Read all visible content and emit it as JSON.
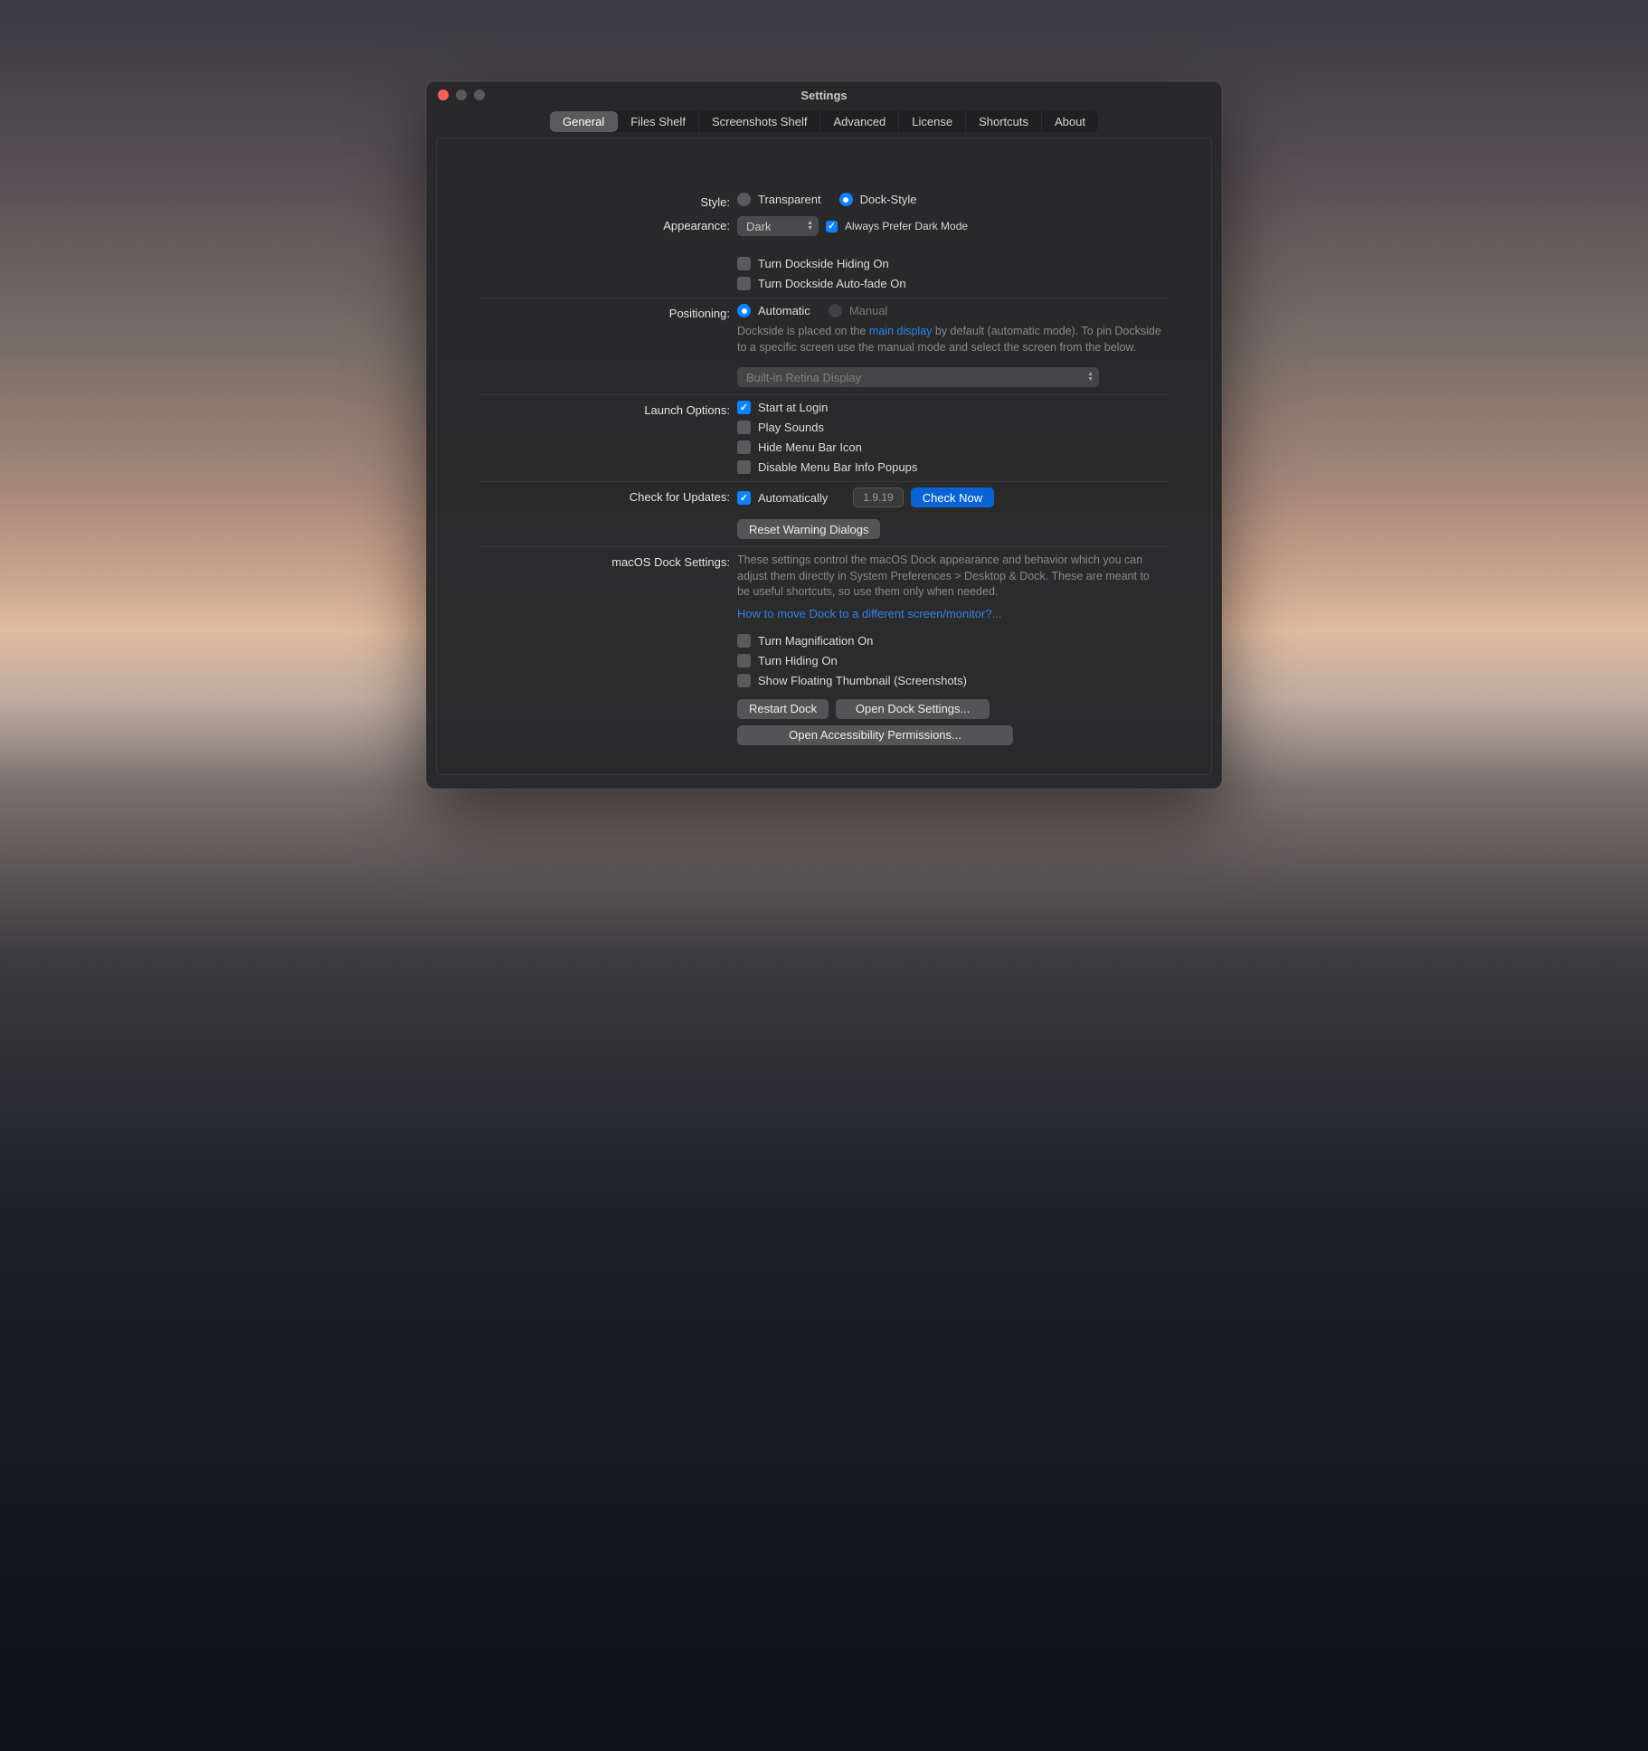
{
  "window": {
    "title": "Settings"
  },
  "tabs": [
    "General",
    "Files Shelf",
    "Screenshots Shelf",
    "Advanced",
    "License",
    "Shortcuts",
    "About"
  ],
  "selected_tab": 0,
  "style": {
    "label": "Style:",
    "options": {
      "transparent": "Transparent",
      "dock": "Dock-Style"
    },
    "selected": "dock"
  },
  "appearance": {
    "label": "Appearance:",
    "value": "Dark",
    "always_dark_label": "Always Prefer Dark Mode",
    "always_dark_checked": true,
    "hiding_label": "Turn Dockside Hiding On",
    "hiding_checked": false,
    "autofade_label": "Turn Dockside Auto-fade On",
    "autofade_checked": false
  },
  "positioning": {
    "label": "Positioning:",
    "options": {
      "automatic": "Automatic",
      "manual": "Manual"
    },
    "selected": "automatic",
    "help_pre": "Dockside is placed on the ",
    "help_link": "main display",
    "help_post": " by default (automatic mode). To pin Dockside to a specific screen use the manual mode and select the screen from the below.",
    "display_value": "Built-in Retina Display"
  },
  "launch": {
    "label": "Launch Options:",
    "start_login": {
      "label": "Start at Login",
      "checked": true
    },
    "play_sounds": {
      "label": "Play Sounds",
      "checked": false
    },
    "hide_menubar": {
      "label": "Hide Menu Bar Icon",
      "checked": false
    },
    "disable_popups": {
      "label": "Disable Menu Bar Info Popups",
      "checked": false
    }
  },
  "updates": {
    "label": "Check for Updates:",
    "auto_label": "Automatically",
    "auto_checked": true,
    "version": "1.9.19",
    "check_now": "Check Now",
    "reset_dialogs": "Reset Warning Dialogs"
  },
  "dock": {
    "label": "macOS Dock Settings:",
    "help": "These settings control the macOS Dock appearance and behavior which you can adjust them directly in System Preferences > Desktop & Dock. These are meant to be useful shortcuts, so use them only when needed.",
    "help_link": "How to move Dock to a different screen/monitor?...",
    "magnification": {
      "label": "Turn Magnification On",
      "checked": false
    },
    "hiding": {
      "label": "Turn Hiding On",
      "checked": false
    },
    "thumbnail": {
      "label": "Show Floating Thumbnail (Screenshots)",
      "checked": false
    },
    "restart": "Restart Dock",
    "open_settings": "Open Dock Settings...",
    "open_accessibility": "Open Accessibility Permissions..."
  }
}
